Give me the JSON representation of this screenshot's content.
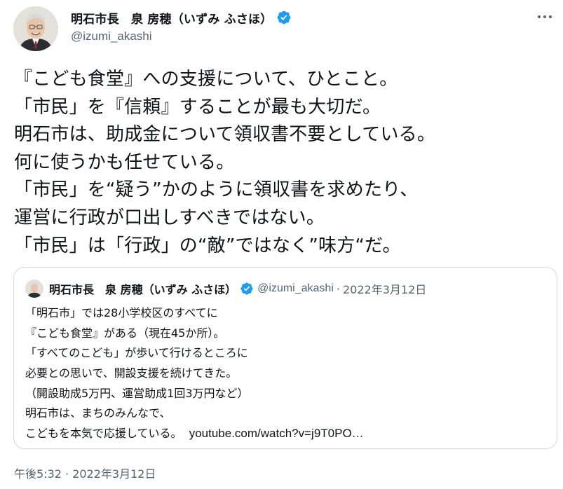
{
  "tweet": {
    "author_name": "明石市長　泉 房穂（いずみ ふさほ）",
    "handle": "@izumi_akashi",
    "lines": [
      "『こども食堂』への支援について、ひとこと。",
      "「市民」を『信頼』することが最も大切だ。",
      "明石市は、助成金について領収書不要としている。",
      "何に使うかも任せている。",
      "「市民」を“疑う”かのように領収書を求めたり、",
      "運営に行政が口出しすべきではない。",
      "「市民」は「行政」の“敵”ではなく”味方“だ。"
    ],
    "timestamp": "午後5:32 · 2022年3月12日"
  },
  "quoted": {
    "author_name": "明石市長　泉 房穂（いずみ ふさほ）",
    "handle": "@izumi_akashi",
    "separator": "·",
    "date": "2022年3月12日",
    "lines": [
      "「明石市」では28小学校区のすべてに",
      "『こども食堂』がある（現在45か所）。",
      "「すべてのこども」が歩いて行けるところに",
      "必要との思いで、開設支援を続けてきた。",
      "（開設助成5万円、運営助成1回3万円など）",
      "明石市は、まちのみんなで、",
      "こどもを本気で応援している。"
    ],
    "link_text": "youtube.com/watch?v=j9T0PO…"
  },
  "colors": {
    "verified": "#1d9bf0",
    "text": "#0f1419",
    "secondary": "#536471",
    "border": "#cfd9de"
  },
  "icons": {
    "verified": "verified-badge-icon",
    "more": "more-options-icon"
  }
}
